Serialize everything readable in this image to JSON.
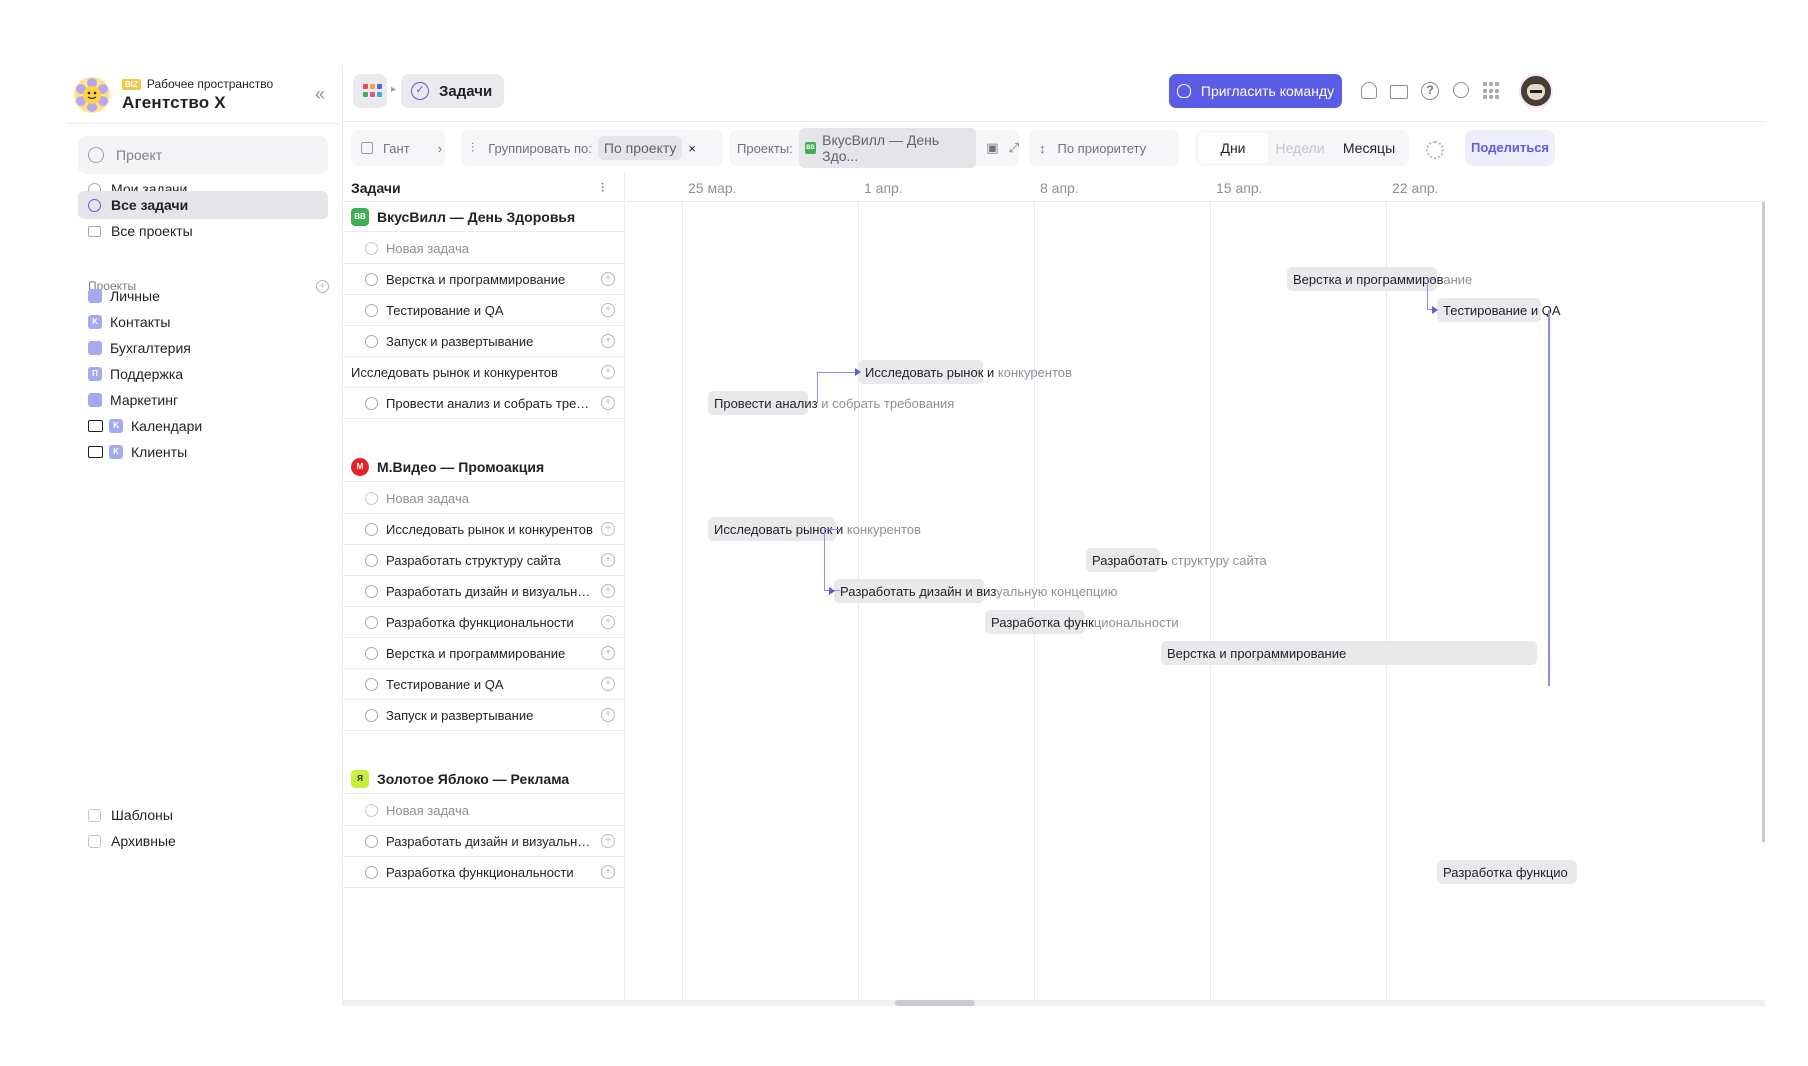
{
  "workspace": {
    "badge": "BIZ",
    "label": "Рабочее пространство",
    "name": "Агентство X"
  },
  "sidebar": {
    "search_placeholder": "Проект",
    "nav": [
      {
        "label": "Мои задачи"
      },
      {
        "label": "Все задачи",
        "active": true
      },
      {
        "label": "Все проекты"
      }
    ],
    "projects_title": "Проекты",
    "projects": [
      {
        "label": "Личные",
        "badge": ""
      },
      {
        "label": "Контакты",
        "badge": "K"
      },
      {
        "label": "Бухгалтерия",
        "badge": ""
      },
      {
        "label": "Поддержка",
        "badge": "П"
      },
      {
        "label": "Маркетинг",
        "badge": ""
      },
      {
        "label": "Календари",
        "badge": "K",
        "folder": true
      },
      {
        "label": "Клиенты",
        "badge": "K",
        "folder": true
      }
    ],
    "bottom": [
      {
        "label": "Шаблоны"
      },
      {
        "label": "Архивные"
      }
    ]
  },
  "header": {
    "breadcrumb": "Задачи",
    "invite_label": "Пригласить команду"
  },
  "toolbar": {
    "view": "Гант",
    "group_label": "Группировать по:",
    "group_value": "По проекту",
    "projects_label": "Проекты:",
    "projects_value": "ВкусВилл — День Здо...",
    "sort": "По приоритету",
    "scale": [
      "Дни",
      "Недели",
      "Месяцы"
    ],
    "share": "Поделиться"
  },
  "gantt": {
    "tasks_header": "Задачи",
    "weeks": [
      "25 мар.",
      "1 апр.",
      "8 апр.",
      "15 апр.",
      "22 апр."
    ],
    "new_task": "Новая задача",
    "groups": [
      {
        "name": "ВкусВилл — День Здоровья",
        "badge": "ВВ",
        "color": "#3fae55",
        "tasks": [
          "Верстка и программирование",
          "Тестирование и QA",
          "Запуск и развертывание",
          "Исследовать рынок и конкурентов",
          "Провести анализ и собрать требован..."
        ]
      },
      {
        "name": "М.Видео — Промоакция",
        "badge": "М",
        "color": "#e3262b",
        "tasks": [
          "Исследовать рынок и конкурентов",
          "Разработать структуру сайта",
          "Разработать дизайн и визуальную ...",
          "Разработка функциональности",
          "Верстка и программирование",
          "Тестирование и QA",
          "Запуск и развертывание"
        ]
      },
      {
        "name": "Золотое Яблоко — Реклама",
        "badge": "Я",
        "color": "#c8f03a",
        "tasks": [
          "Разработать дизайн и визуальную ...",
          "Разработка функциональности"
        ]
      }
    ],
    "bars": [
      {
        "in": "Верстка и программиров",
        "out": "ание"
      },
      {
        "in": "Тестирование и QA",
        "out": ""
      },
      {
        "in": "Исследовать рынок и",
        "out": " конкурентов"
      },
      {
        "in": "Провести анализ",
        "out": " и собрать требования"
      },
      {
        "in": "Исследовать рынок и",
        "out": " конкурентов"
      },
      {
        "in": "Разработать",
        "out": " структуру сайта"
      },
      {
        "in": "Разработать дизайн и виз",
        "out": "уальную концепцию"
      },
      {
        "in": "Разработка функ",
        "out": "циональности"
      },
      {
        "in": "Верстка и программирование",
        "out": ""
      },
      {
        "in": "Разработка функцио",
        "out": ""
      }
    ]
  }
}
